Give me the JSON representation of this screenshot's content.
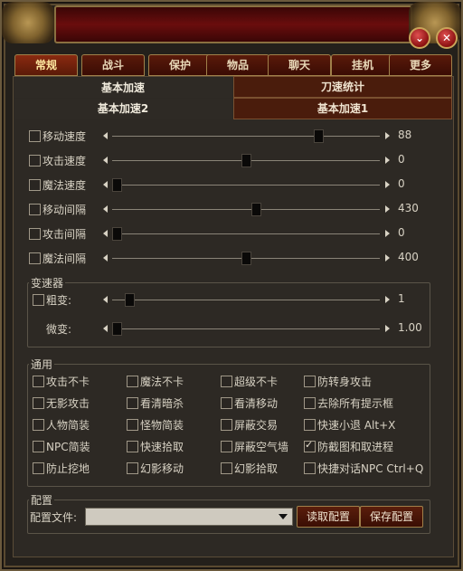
{
  "window": {
    "title": ""
  },
  "tabs": [
    "常规",
    "战斗",
    "保护",
    "物品",
    "聊天",
    "挂机",
    "更多"
  ],
  "active_tab": "常规",
  "subtabs": {
    "row1": [
      "基本加速",
      "刀速统计"
    ],
    "row2": [
      "基本加速2",
      "基本加速1"
    ]
  },
  "sliders": [
    {
      "label": "移动速度",
      "value": "88",
      "checked": false,
      "level": 0.78
    },
    {
      "label": "攻击速度",
      "value": "0",
      "checked": false,
      "level": 0.5
    },
    {
      "label": "魔法速度",
      "value": "0",
      "checked": false,
      "level": 0.0
    },
    {
      "label": "移动间隔",
      "value": "430",
      "checked": false,
      "level": 0.54
    },
    {
      "label": "攻击间隔",
      "value": "0",
      "checked": false,
      "level": 0.0
    },
    {
      "label": "魔法间隔",
      "value": "400",
      "checked": false,
      "level": 0.5
    }
  ],
  "speeder": {
    "title": "变速器",
    "coarse": {
      "label": "粗变:",
      "value": "1",
      "checked": false,
      "level": 0.05
    },
    "fine": {
      "label": "微变:",
      "value": "1.00",
      "level": 0.0
    }
  },
  "general": {
    "title": "通用",
    "options": [
      [
        "攻击不卡",
        "魔法不卡",
        "超级不卡",
        "防转身攻击"
      ],
      [
        "无影攻击",
        "看清暗杀",
        "看清移动",
        "去除所有提示框"
      ],
      [
        "人物简装",
        "怪物简装",
        "屏蔽交易",
        "快速小退 Alt+X"
      ],
      [
        "NPC简装",
        "快速拾取",
        "屏蔽空气墙",
        "防截图和取进程"
      ],
      [
        "防止挖地",
        "幻影移动",
        "幻影拾取",
        "快捷对话NPC Ctrl+Q"
      ]
    ],
    "checked": [
      "防截图和取进程"
    ]
  },
  "config": {
    "title": "配置",
    "file_label": "配置文件:",
    "file_value": "",
    "read_button": "读取配置",
    "save_button": "保存配置"
  }
}
